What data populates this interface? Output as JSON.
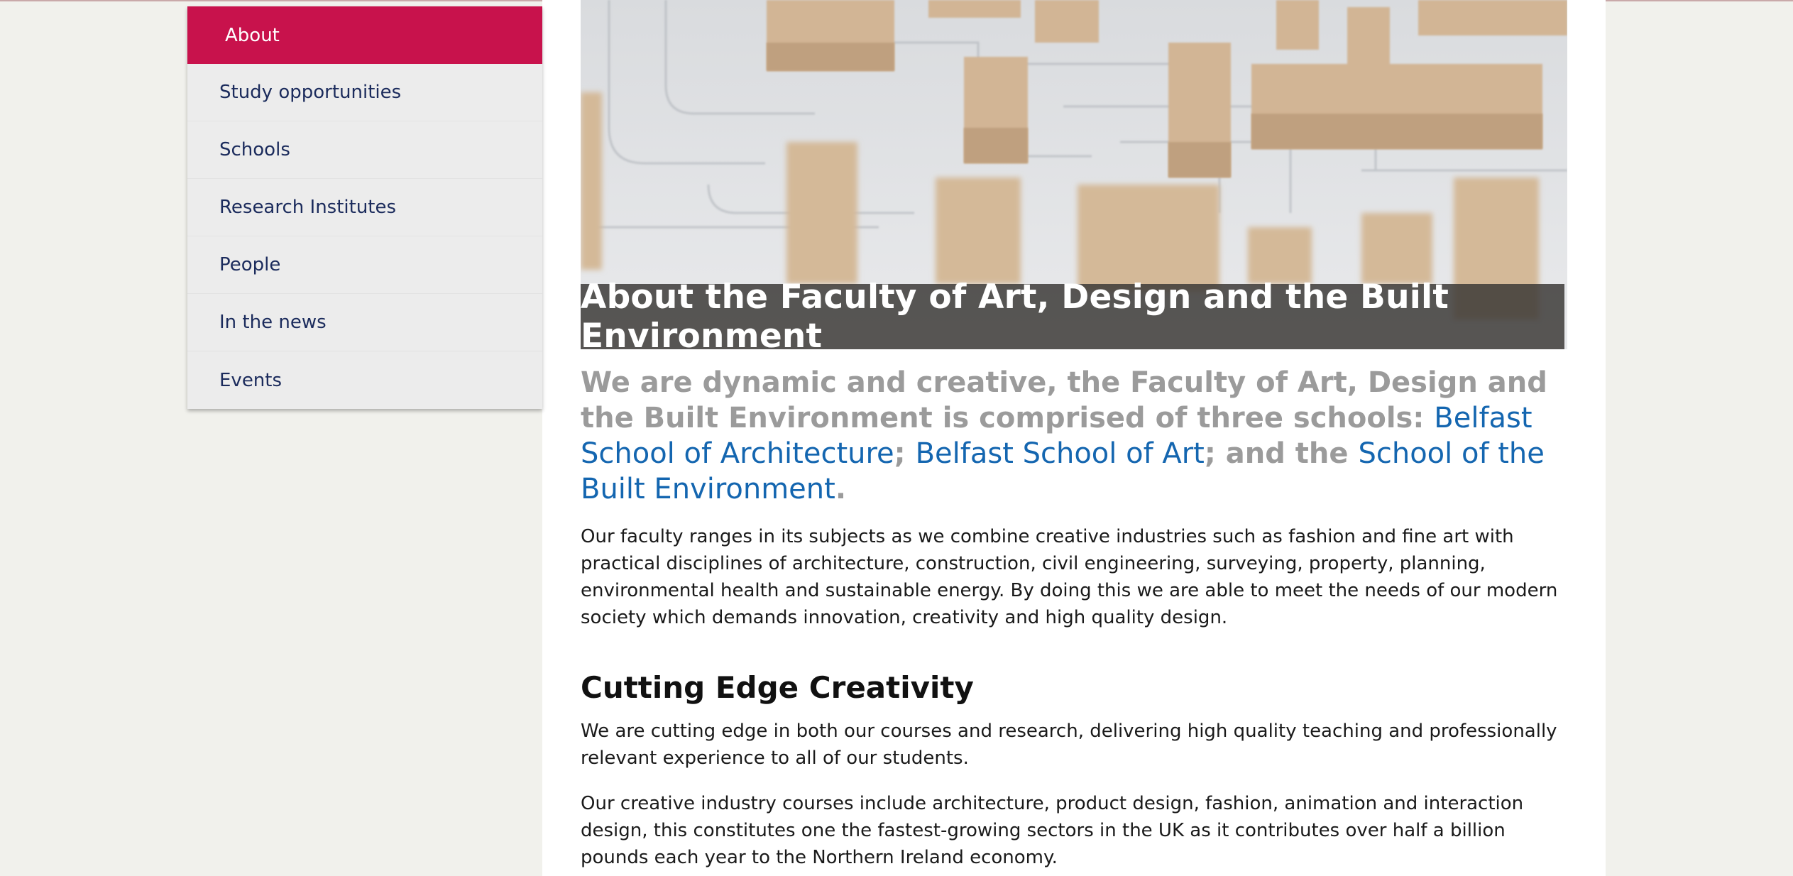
{
  "sidebar": {
    "items": [
      {
        "label": "About"
      },
      {
        "label": "Study opportunities"
      },
      {
        "label": "Schools"
      },
      {
        "label": "Research Institutes"
      },
      {
        "label": "People"
      },
      {
        "label": "In the news"
      },
      {
        "label": "Events"
      }
    ]
  },
  "hero": {
    "caption": "About the Faculty of Art, Design and the Built Environment"
  },
  "intro": {
    "text1": "We are dynamic and creative, the Faculty of Art, Design and the Built Environment is comprised of three schools: ",
    "link1": "Belfast School of Architecture",
    "sep1": "; ",
    "link2": "Belfast School of Art",
    "text2": "; and the ",
    "link3": "School of the Built Environment",
    "end": "."
  },
  "main": {
    "p1": "Our faculty ranges in its subjects as we combine creative industries such as fashion and fine art with practical disciplines of architecture, construction, civil engineering, surveying, property, planning, environmental health and sustainable energy. By doing this we are able to meet the needs of our modern society which demands innovation, creativity and high quality design.",
    "heading": "Cutting Edge Creativity",
    "p2": "We are cutting edge in both our courses and research, delivering high quality teaching and professionally relevant experience to all of our students.",
    "p3": "Our creative industry courses include architecture, product design, fashion, animation and interaction design, this constitutes one the fastest-growing sectors in the UK as it contributes over half a billion pounds each year to the Northern Ireland economy."
  },
  "colors": {
    "accent": "#c8124c",
    "link": "#1466b0",
    "nav_text": "#1b2b5c",
    "intro_grey": "#9b9b9b"
  }
}
